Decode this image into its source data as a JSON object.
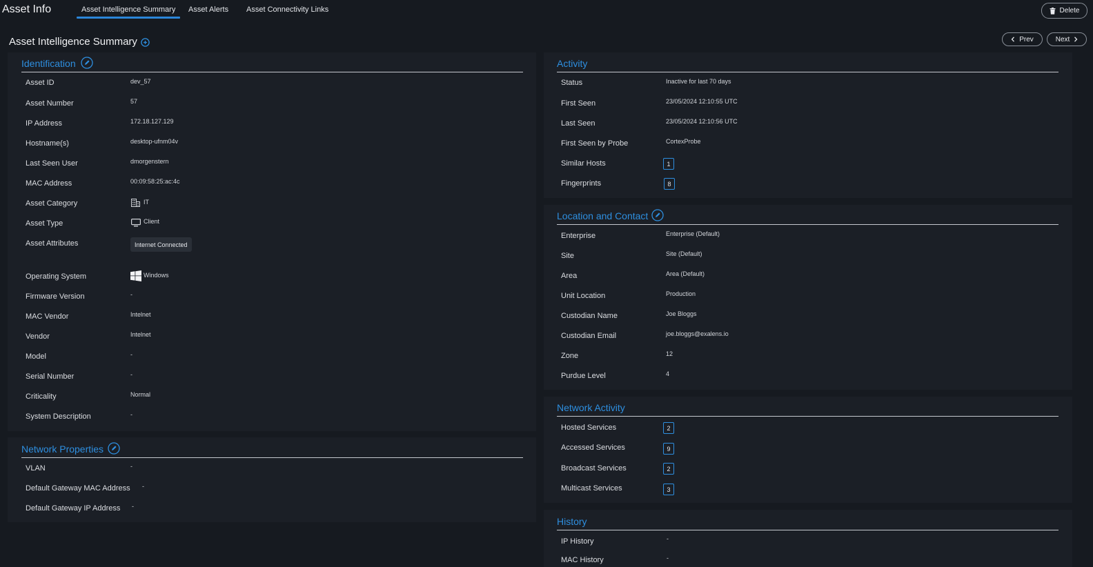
{
  "app": {
    "title": "Asset Info",
    "tabs": [
      {
        "label": "Asset Intelligence Summary",
        "active": true
      },
      {
        "label": "Asset Alerts",
        "active": false
      },
      {
        "label": "Asset Connectivity Links",
        "active": false
      }
    ],
    "delete_label": "Delete"
  },
  "page": {
    "title": "Asset Intelligence Summary",
    "prev_label": "Prev",
    "next_label": "Next"
  },
  "identification": {
    "title": "Identification",
    "rows": [
      {
        "label": "Asset ID",
        "value": "dev_57"
      },
      {
        "label": "Asset Number",
        "value": "57"
      },
      {
        "label": "IP Address",
        "value": "172.18.127.129"
      },
      {
        "label": "Hostname(s)",
        "value": "desktop-ufnm04v"
      },
      {
        "label": "Last Seen User",
        "value": "dmorgenstern"
      },
      {
        "label": "MAC Address",
        "value": "00:09:58:25:ac:4c"
      },
      {
        "label": "Asset Category",
        "value": "IT",
        "icon": "building-icon"
      },
      {
        "label": "Asset Type",
        "value": "Client",
        "icon": "monitor-icon"
      },
      {
        "label": "Asset Attributes",
        "chip": "Internet Connected"
      },
      {
        "label": "Operating System",
        "value": "Windows",
        "icon": "windows-icon"
      },
      {
        "label": "Firmware Version",
        "value": "-"
      },
      {
        "label": "MAC Vendor",
        "value": "Intelnet"
      },
      {
        "label": "Vendor",
        "value": "Intelnet"
      },
      {
        "label": "Model",
        "value": "-"
      },
      {
        "label": "Serial Number",
        "value": "-"
      },
      {
        "label": "Criticality",
        "value": "Normal"
      },
      {
        "label": "System Description",
        "value": "-"
      }
    ]
  },
  "network_properties": {
    "title": "Network Properties",
    "rows": [
      {
        "label": "VLAN",
        "value": "-"
      },
      {
        "label": "Default Gateway MAC Address",
        "value": "-"
      },
      {
        "label": "Default Gateway IP Address",
        "value": "-"
      }
    ]
  },
  "activity": {
    "title": "Activity",
    "rows": [
      {
        "label": "Status",
        "value": "Inactive for last 70 days"
      },
      {
        "label": "First Seen",
        "value": "23/05/2024 12:10:55 UTC"
      },
      {
        "label": "Last Seen",
        "value": "23/05/2024 12:10:56 UTC"
      },
      {
        "label": "First Seen by Probe",
        "value": "CortexProbe"
      },
      {
        "label": "Similar Hosts",
        "badge": "1"
      },
      {
        "label": "Fingerprints",
        "badge": "8"
      }
    ]
  },
  "location": {
    "title": "Location and Contact",
    "rows": [
      {
        "label": "Enterprise",
        "value": "Enterprise (Default)"
      },
      {
        "label": "Site",
        "value": "Site (Default)"
      },
      {
        "label": "Area",
        "value": "Area (Default)"
      },
      {
        "label": "Unit Location",
        "value": "Production"
      },
      {
        "label": "Custodian Name",
        "value": "Joe Bloggs"
      },
      {
        "label": "Custodian Email",
        "value": "joe.bloggs@exalens.io"
      },
      {
        "label": "Zone",
        "value": "12"
      },
      {
        "label": "Purdue Level",
        "value": "4"
      }
    ]
  },
  "network_activity": {
    "title": "Network Activity",
    "rows": [
      {
        "label": "Hosted Services",
        "badge": "2"
      },
      {
        "label": "Accessed Services",
        "badge": "9"
      },
      {
        "label": "Broadcast Services",
        "badge": "2"
      },
      {
        "label": "Multicast Services",
        "badge": "3"
      }
    ]
  },
  "history": {
    "title": "History",
    "rows": [
      {
        "label": "IP History",
        "value": "-"
      },
      {
        "label": "MAC History",
        "value": "-"
      }
    ]
  },
  "colors": {
    "accent": "#2e8fe0",
    "background": "#161a20",
    "panel": "#1b1f26"
  }
}
